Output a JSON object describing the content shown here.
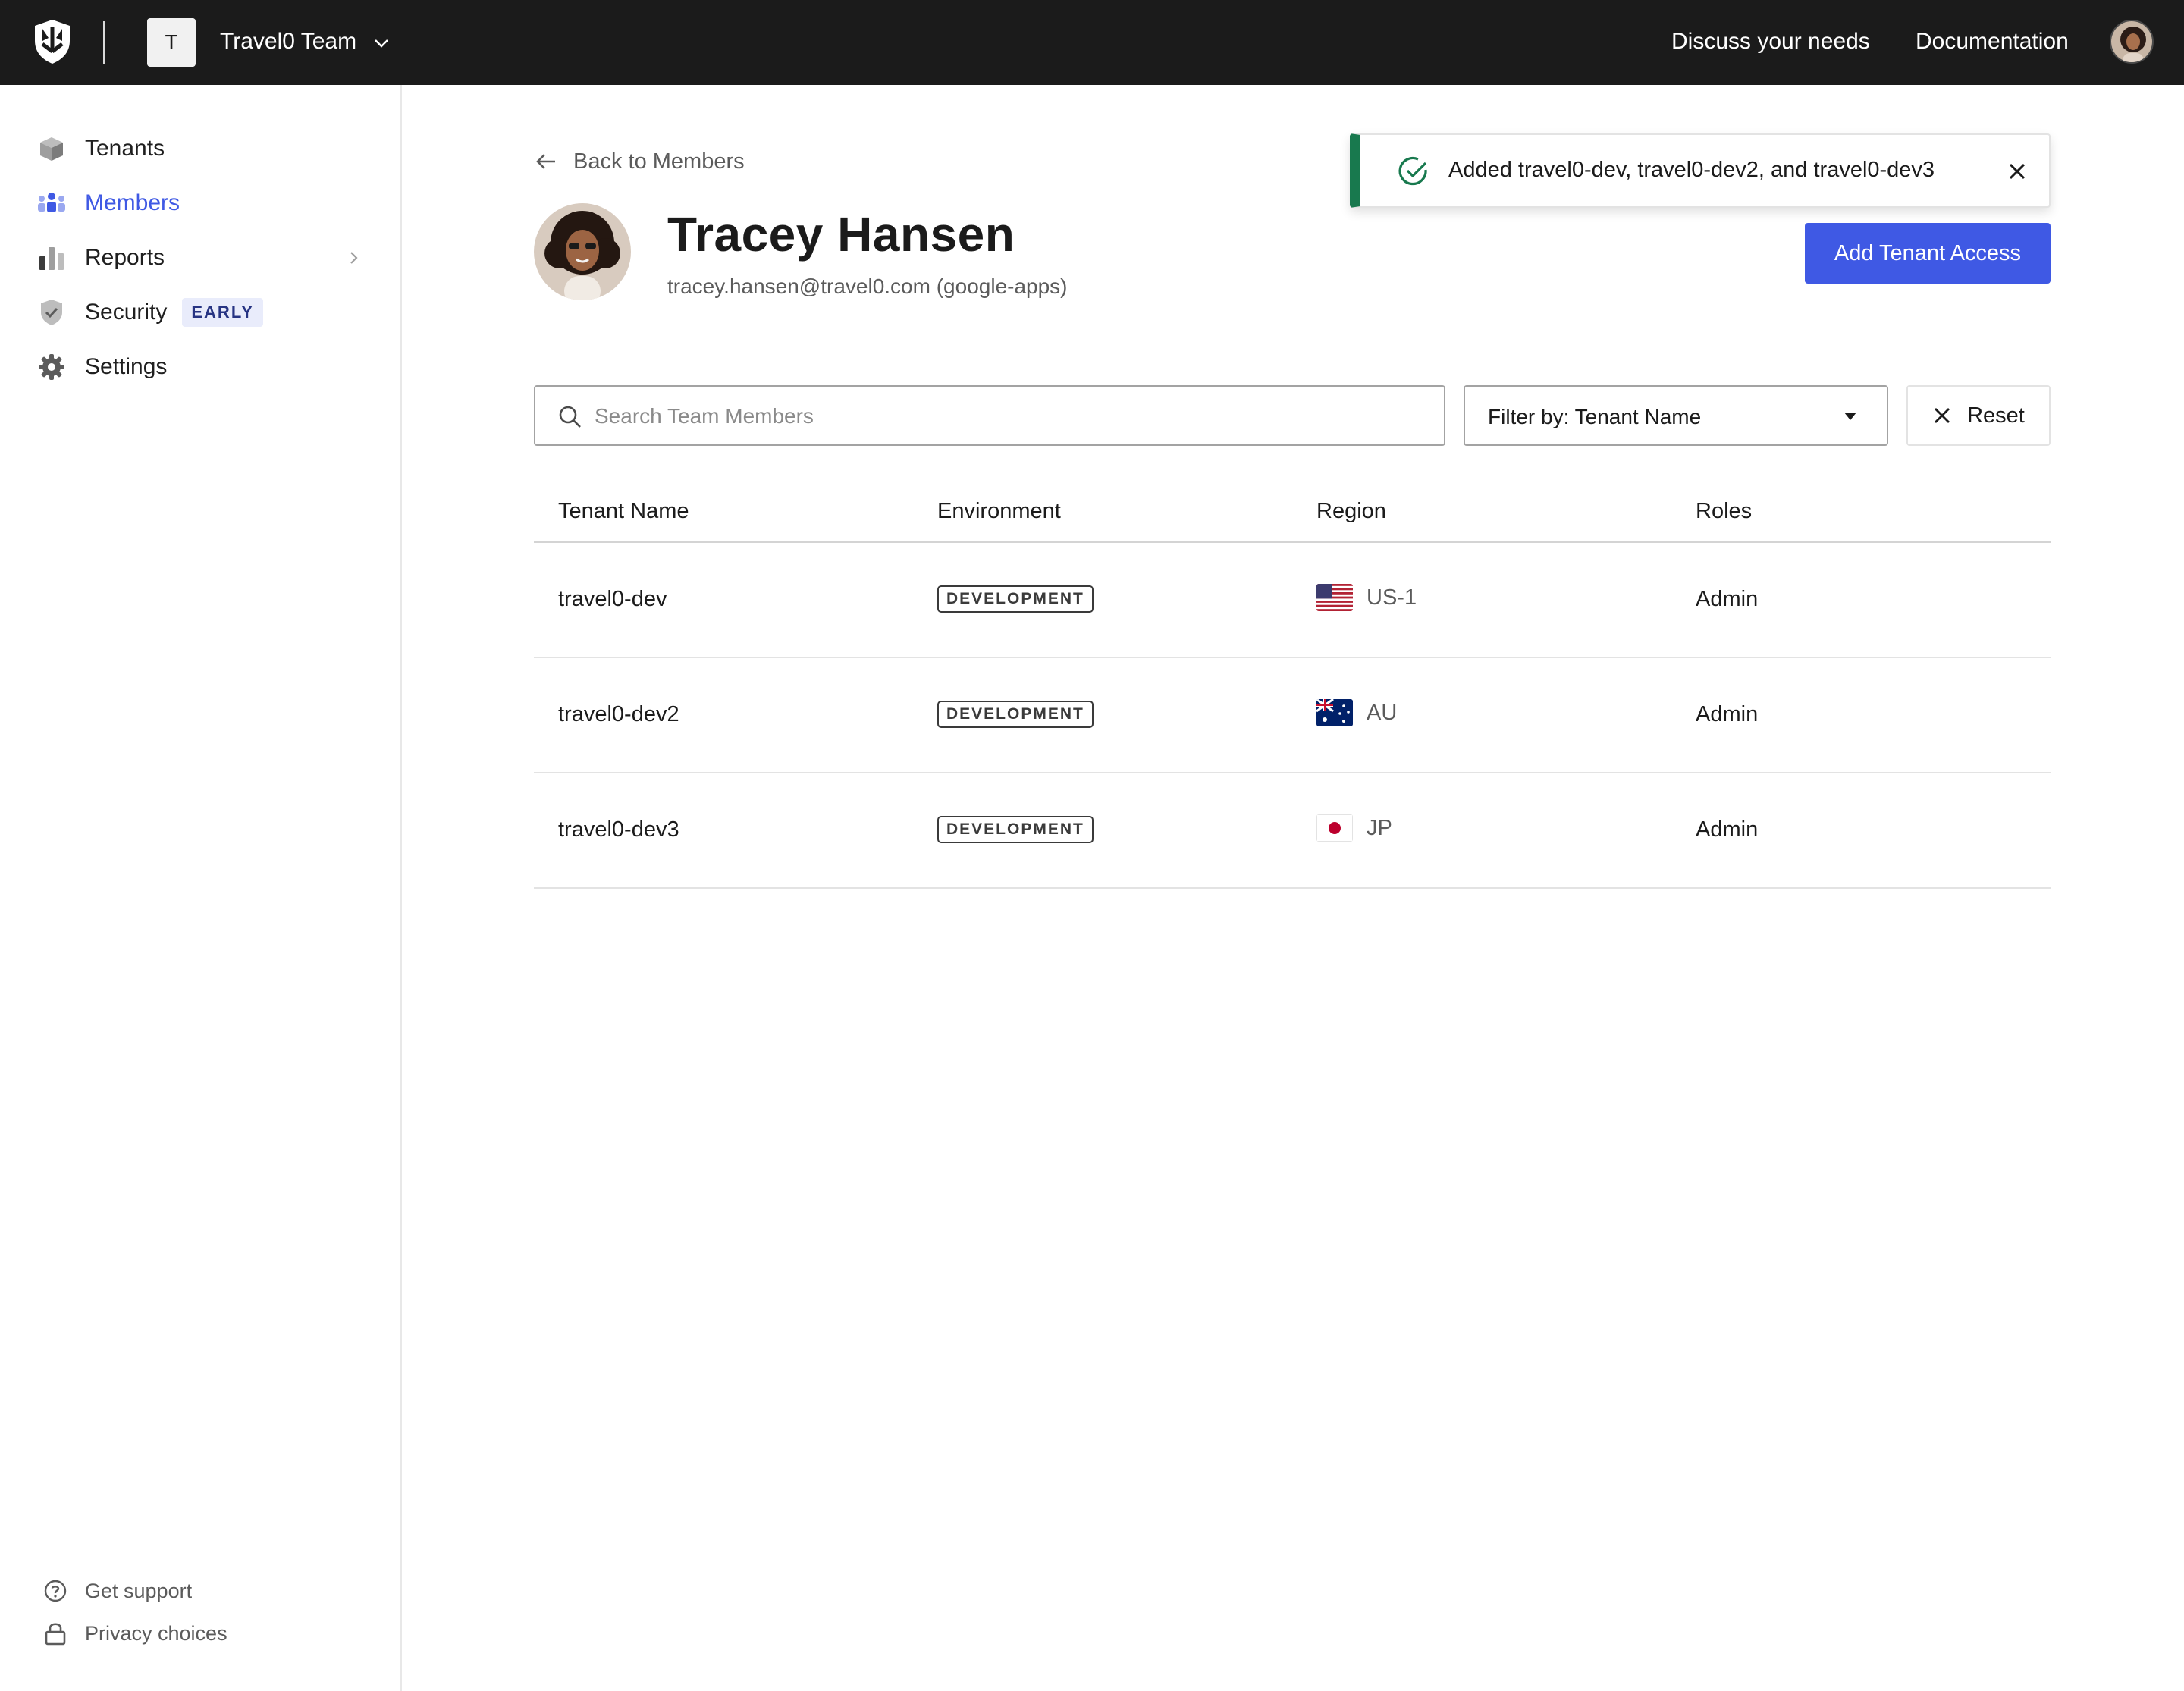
{
  "topbar": {
    "team_initial": "T",
    "team_name": "Travel0 Team",
    "links": {
      "discuss": "Discuss your needs",
      "docs": "Documentation"
    }
  },
  "sidebar": {
    "items": [
      {
        "label": "Tenants",
        "icon": "cube-icon"
      },
      {
        "label": "Members",
        "icon": "members-icon",
        "active": true
      },
      {
        "label": "Reports",
        "icon": "bar-chart-icon"
      },
      {
        "label": "Security",
        "icon": "shield-check-icon",
        "badge": "EARLY"
      },
      {
        "label": "Settings",
        "icon": "gear-icon"
      }
    ],
    "footer": [
      {
        "label": "Get support",
        "icon": "help-circle-icon"
      },
      {
        "label": "Privacy choices",
        "icon": "lock-icon"
      }
    ]
  },
  "page": {
    "back_label": "Back to Members",
    "member": {
      "name": "Tracey Hansen",
      "email": "tracey.hansen@travel0.com (google-apps)"
    },
    "add_button": "Add Tenant Access",
    "toast": {
      "message": "Added travel0-dev, travel0-dev2, and travel0-dev3",
      "status_color": "#18794e"
    },
    "search": {
      "placeholder": "Search Team Members",
      "value": ""
    },
    "filter": {
      "label": "Filter by: Tenant Name"
    },
    "reset_label": "Reset",
    "table": {
      "columns": [
        "Tenant Name",
        "Environment",
        "Region",
        "Roles"
      ],
      "rows": [
        {
          "tenant": "travel0-dev",
          "environment": "DEVELOPMENT",
          "region": "US-1",
          "flag": "us-flag-icon",
          "role": "Admin"
        },
        {
          "tenant": "travel0-dev2",
          "environment": "DEVELOPMENT",
          "region": "AU",
          "flag": "au-flag-icon",
          "role": "Admin"
        },
        {
          "tenant": "travel0-dev3",
          "environment": "DEVELOPMENT",
          "region": "JP",
          "flag": "jp-flag-icon",
          "role": "Admin"
        }
      ]
    }
  },
  "colors": {
    "accent": "#3f59e4",
    "topbar": "#1b1b1b",
    "success": "#18794e"
  }
}
